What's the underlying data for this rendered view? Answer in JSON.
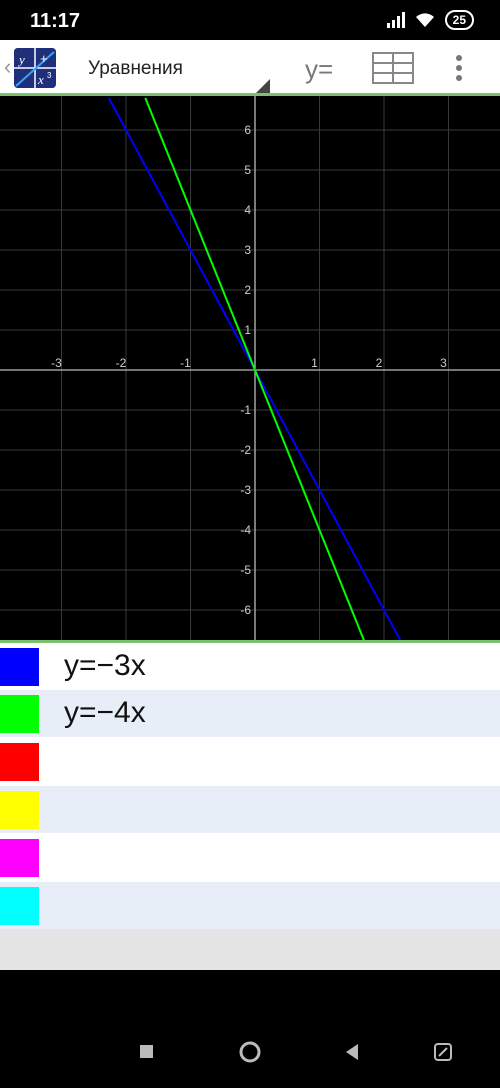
{
  "status": {
    "time": "11:17",
    "battery": "25"
  },
  "toolbar": {
    "title": "Уравнения",
    "yeq_label": "y="
  },
  "graph": {
    "x_ticks": [
      "-3",
      "-2",
      "-1",
      "1",
      "2",
      "3"
    ],
    "y_ticks": [
      "6",
      "5",
      "4",
      "3",
      "2",
      "1",
      "-1",
      "-2",
      "-3",
      "-4",
      "-5",
      "-6"
    ],
    "xlim": [
      -4,
      4
    ],
    "ylim": [
      -6.8,
      6.8
    ],
    "functions": [
      {
        "label": "y=−3x",
        "slope": -3,
        "color": "#0000ff"
      },
      {
        "label": "y=−4x",
        "slope": -4,
        "color": "#00ff00"
      }
    ]
  },
  "equations": [
    {
      "text": "y=−3x",
      "color": "#0000ff"
    },
    {
      "text": "y=−4x",
      "color": "#00ff00"
    },
    {
      "text": "",
      "color": "#ff0000"
    },
    {
      "text": "",
      "color": "#ffff00"
    },
    {
      "text": "",
      "color": "#ff00ff"
    },
    {
      "text": "",
      "color": "#00ffff"
    }
  ]
}
